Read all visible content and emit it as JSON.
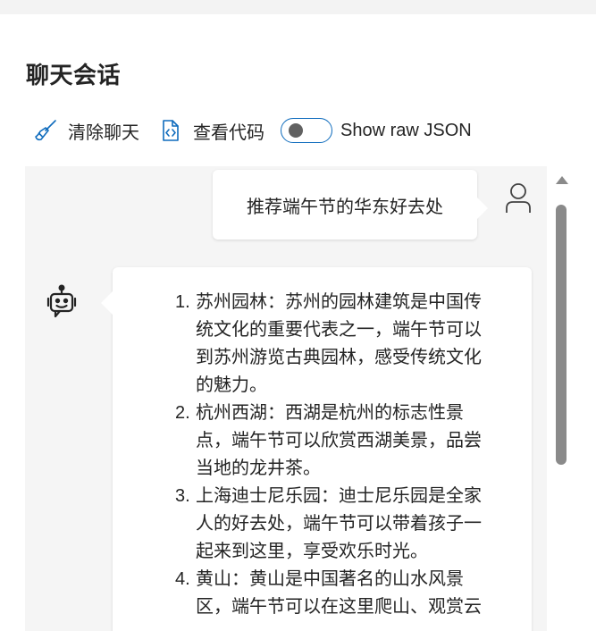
{
  "page": {
    "title": "聊天会话"
  },
  "toolbar": {
    "clear_label": "清除聊天",
    "code_label": "查看代码",
    "toggle_label": "Show raw JSON",
    "toggle_on": false
  },
  "chat": {
    "user_message": "推荐端午节的华东好去处",
    "assistant_items": [
      {
        "num": "1.",
        "text": "苏州园林：苏州的园林建筑是中国传统文化的重要代表之一，端午节可以到苏州游览古典园林，感受传统文化的魅力。"
      },
      {
        "num": "2.",
        "text": "杭州西湖：西湖是杭州的标志性景点，端午节可以欣赏西湖美景，品尝当地的龙井茶。"
      },
      {
        "num": "3.",
        "text": "上海迪士尼乐园：迪士尼乐园是全家人的好去处，端午节可以带着孩子一起来到这里，享受欢乐时光。"
      },
      {
        "num": "4.",
        "text": "黄山：黄山是中国著名的山水风景区，端午节可以在这里爬山、观赏云"
      }
    ]
  },
  "colors": {
    "accent": "#0f6cbd",
    "chat_bg": "#f5f5f5",
    "text": "#242424"
  },
  "icons": {
    "clear": "broom-icon",
    "code": "code-file-icon",
    "user": "person-icon",
    "bot": "bot-icon"
  }
}
